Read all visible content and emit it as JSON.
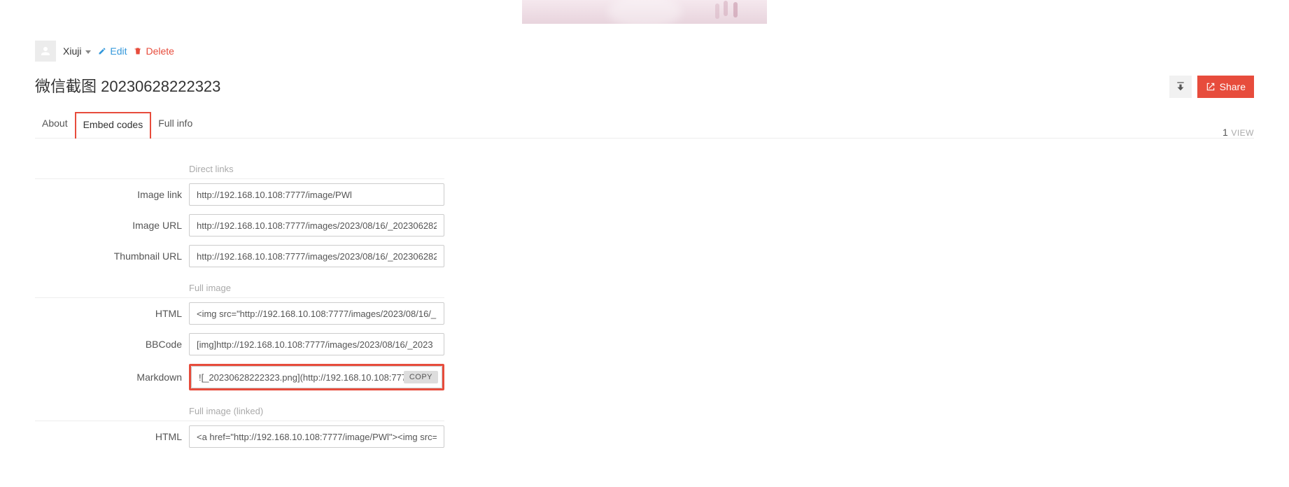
{
  "user": {
    "name": "Xiuji"
  },
  "actions": {
    "edit_label": "Edit",
    "delete_label": "Delete"
  },
  "title": "微信截图 20230628222323",
  "tabs": {
    "about": "About",
    "embed_codes": "Embed codes",
    "full_info": "Full info"
  },
  "views": {
    "count": "1",
    "label": "VIEW"
  },
  "right": {
    "share_label": "Share"
  },
  "sections": {
    "direct_links": "Direct links",
    "full_image": "Full image",
    "full_image_linked": "Full image (linked)"
  },
  "labels": {
    "image_link": "Image link",
    "image_url": "Image URL",
    "thumbnail_url": "Thumbnail URL",
    "html": "HTML",
    "bbcode": "BBCode",
    "markdown": "Markdown"
  },
  "values": {
    "image_link": "http://192.168.10.108:7777/image/PWl",
    "image_url": "http://192.168.10.108:7777/images/2023/08/16/_202306282",
    "thumbnail_url": "http://192.168.10.108:7777/images/2023/08/16/_202306282",
    "full_html": "<img src=\"http://192.168.10.108:7777/images/2023/08/16/_",
    "bbcode": "[img]http://192.168.10.108:7777/images/2023/08/16/_2023",
    "markdown": "![_20230628222323.png](http://192.168.10.108:7777",
    "linked_html": "<a href=\"http://192.168.10.108:7777/image/PWl\"><img src="
  },
  "copy_label": "COPY"
}
